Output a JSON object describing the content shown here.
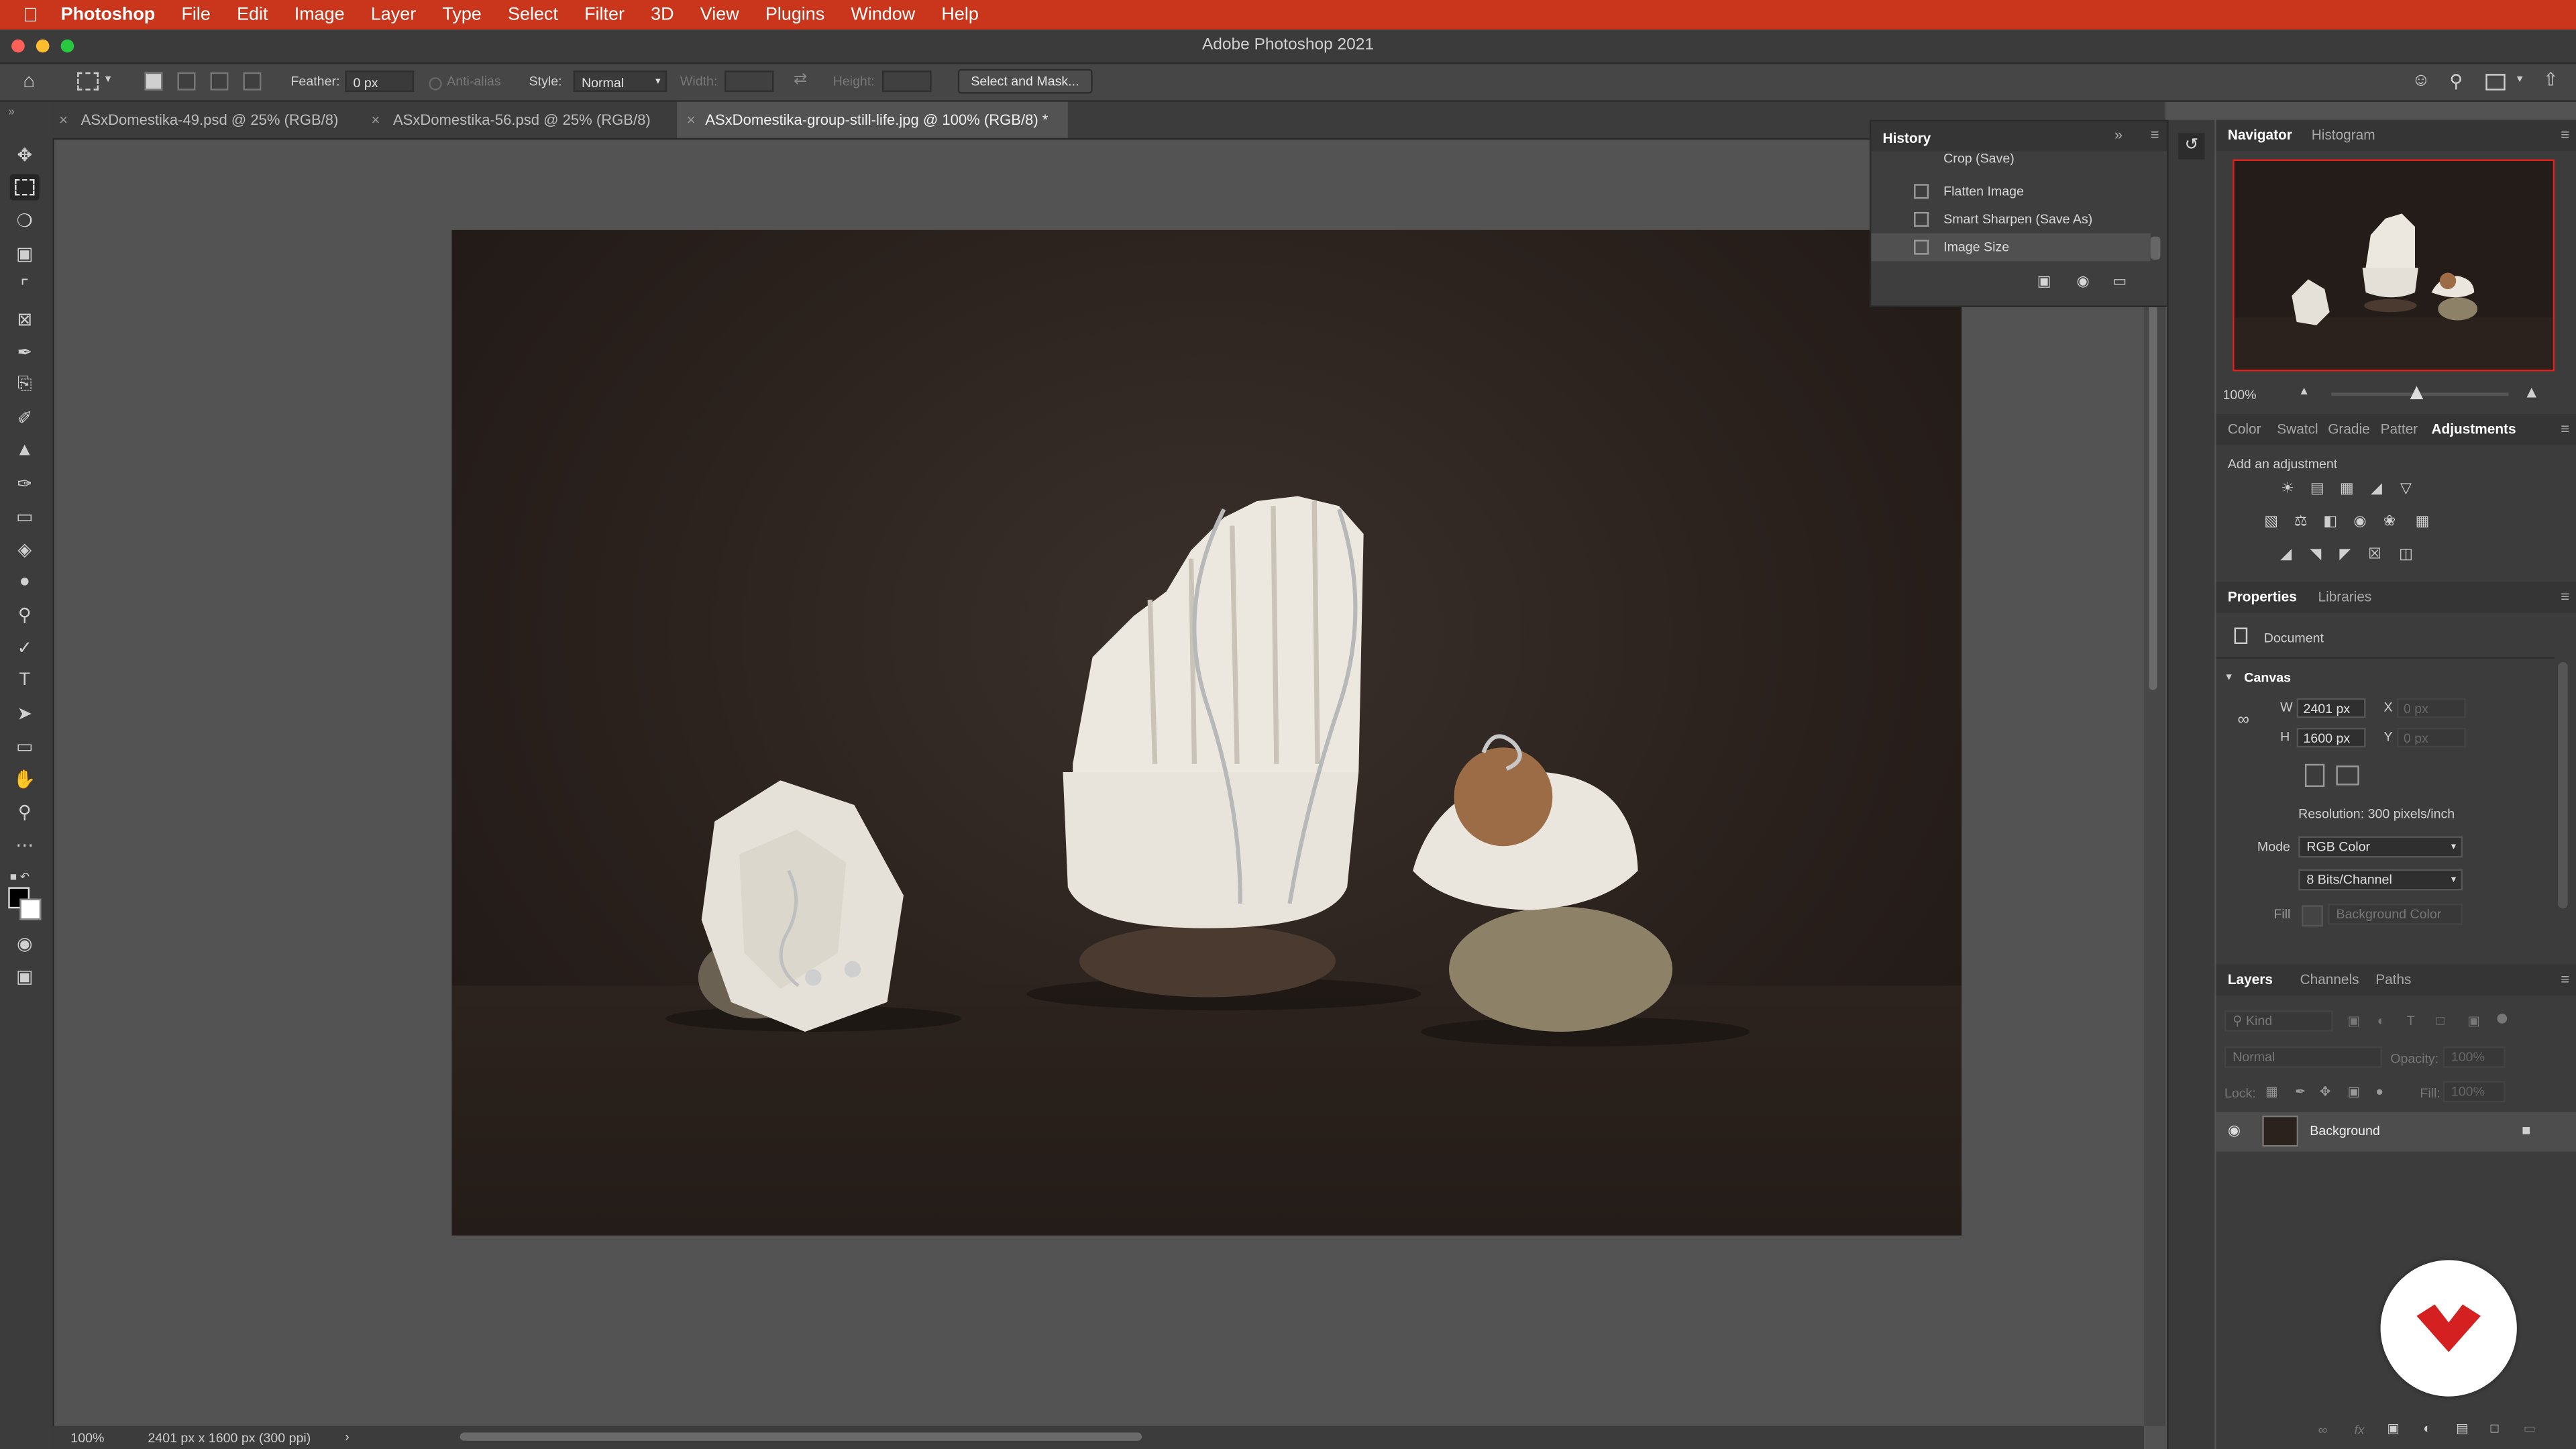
{
  "menubar": {
    "app_name": "Photoshop",
    "items": [
      "File",
      "Edit",
      "Image",
      "Layer",
      "Type",
      "Select",
      "Filter",
      "3D",
      "View",
      "Plugins",
      "Window",
      "Help"
    ]
  },
  "window": {
    "title": "Adobe Photoshop 2021"
  },
  "options_bar": {
    "feather_label": "Feather:",
    "feather_value": "0 px",
    "anti_alias_label": "Anti-alias",
    "style_label": "Style:",
    "style_value": "Normal",
    "width_label": "Width:",
    "height_label": "Height:",
    "select_mask_label": "Select and Mask..."
  },
  "tabs": [
    {
      "label": "ASxDomestika-49.psd @ 25% (RGB/8)"
    },
    {
      "label": "ASxDomestika-56.psd @ 25% (RGB/8)"
    },
    {
      "label": "ASxDomestika-group-still-life.jpg @ 100% (RGB/8) *"
    }
  ],
  "status": {
    "zoom": "100%",
    "doc_info": "2401 px x 1600 px (300 ppi)",
    "arrow": "›"
  },
  "history": {
    "title": "History",
    "items": [
      "Crop (Save)",
      "Flatten Image",
      "Smart Sharpen (Save As)",
      "Image Size"
    ]
  },
  "navigator": {
    "tab1": "Navigator",
    "tab2": "Histogram",
    "zoom": "100%"
  },
  "adjustments_group": {
    "tabs": [
      "Color",
      "Swatcl",
      "Gradie",
      "Patter",
      "Adjustments"
    ],
    "hint": "Add an adjustment"
  },
  "properties": {
    "tab1": "Properties",
    "tab2": "Libraries",
    "doc_label": "Document",
    "canvas_label": "Canvas",
    "w_label": "W",
    "w_value": "2401 px",
    "h_label": "H",
    "h_value": "1600 px",
    "x_label": "X",
    "x_value": "0 px",
    "y_label": "Y",
    "y_value": "0 px",
    "resolution": "Resolution: 300 pixels/inch",
    "mode_label": "Mode",
    "mode_value": "RGB Color",
    "bits_value": "8 Bits/Channel",
    "fill_label": "Fill",
    "fill_value": "Background Color"
  },
  "layers": {
    "tabs": [
      "Layers",
      "Channels",
      "Paths"
    ],
    "kind": "Kind",
    "blend": "Normal",
    "opacity_label": "Opacity:",
    "opacity_value": "100%",
    "lock_label": "Lock:",
    "fill_label": "Fill:",
    "fill_value": "100%",
    "layer_name": "Background"
  },
  "colors": {
    "menubar": "#c9361c",
    "logo_red": "#d42020",
    "navigator_frame": "#e02020"
  }
}
